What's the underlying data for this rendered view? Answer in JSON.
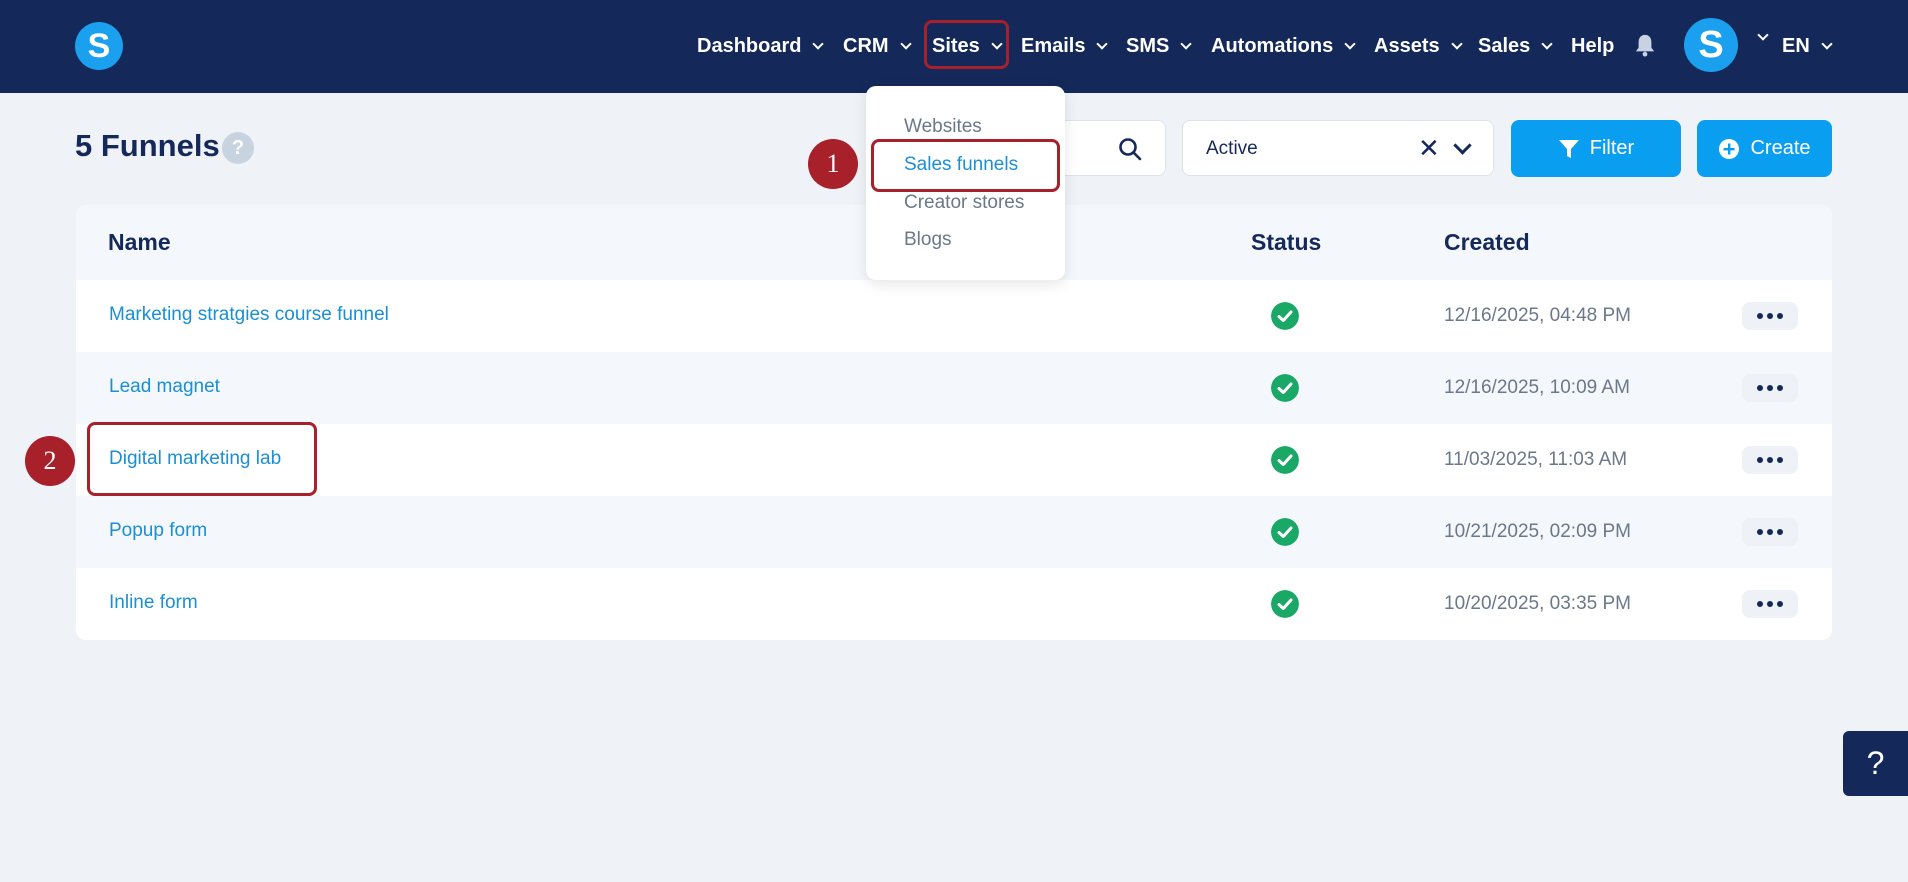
{
  "nav": {
    "logo_letter": "S",
    "items": [
      {
        "label": "Dashboard",
        "has_chevron": true
      },
      {
        "label": "CRM",
        "has_chevron": true
      },
      {
        "label": "Sites",
        "has_chevron": true
      },
      {
        "label": "Emails",
        "has_chevron": true
      },
      {
        "label": "SMS",
        "has_chevron": true
      },
      {
        "label": "Automations",
        "has_chevron": true
      },
      {
        "label": "Assets",
        "has_chevron": true
      },
      {
        "label": "Sales",
        "has_chevron": true
      },
      {
        "label": "Help",
        "has_chevron": false
      }
    ],
    "bell_icon": "bell-icon",
    "avatar_letter": "S",
    "language": "EN"
  },
  "sites_menu": {
    "items": [
      "Websites",
      "Sales funnels",
      "Creator stores",
      "Blogs"
    ],
    "active": "Sales funnels"
  },
  "header": {
    "title": "5 Funnels",
    "help_symbol": "?",
    "status_select_value": "Active",
    "clear_symbol": "✕",
    "filter_label": "Filter",
    "create_label": "Create"
  },
  "table": {
    "columns": [
      "Name",
      "Status",
      "Created"
    ],
    "rows": [
      {
        "name": "Marketing stratgies course funnel",
        "status": "active",
        "created": "12/16/2025, 04:48 PM"
      },
      {
        "name": "Lead magnet",
        "status": "active",
        "created": "12/16/2025, 10:09 AM"
      },
      {
        "name": "Digital marketing lab",
        "status": "active",
        "created": "11/03/2025, 11:03 AM"
      },
      {
        "name": "Popup form",
        "status": "active",
        "created": "10/21/2025, 02:09 PM"
      },
      {
        "name": "Inline form",
        "status": "active",
        "created": "10/20/2025, 03:35 PM"
      }
    ]
  },
  "annotations": [
    {
      "number": "1",
      "target": "Sales funnels"
    },
    {
      "number": "2",
      "target": "Digital marketing lab"
    }
  ],
  "floating_help": "?",
  "colors": {
    "nav_bg": "#14285a",
    "accent": "#0a9ef0",
    "link": "#1a8fd6",
    "status_ok": "#1aa866",
    "annotation": "#a8202a"
  }
}
